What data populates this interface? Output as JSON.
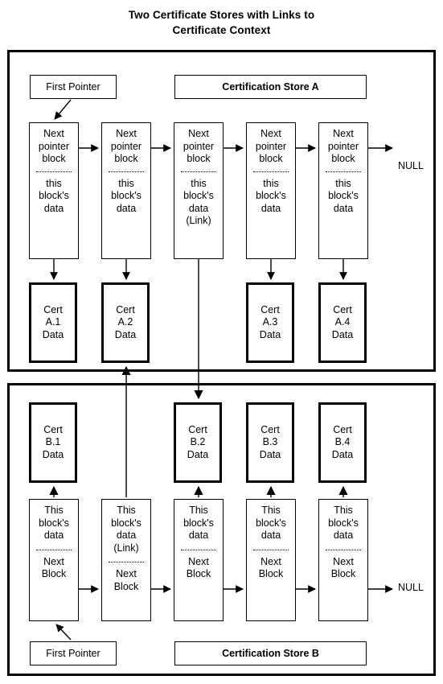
{
  "title": {
    "line1": "Two Certificate Stores with Links to",
    "line2": "Certificate Context"
  },
  "colors": {
    "stroke": "#000000",
    "background": "#ffffff"
  },
  "store_a": {
    "header_label": "Certification Store A",
    "first_pointer_label": "First Pointer",
    "terminator_label": "NULL",
    "nodes": [
      {
        "pointer_part": "Next\npointer\nblock",
        "pointer_l1": "Next",
        "pointer_l2": "pointer",
        "pointer_l3": "block",
        "data_l1": "this",
        "data_l2": "block's",
        "data_l3": "data",
        "data_l4": ""
      },
      {
        "pointer_l1": "Next",
        "pointer_l2": "pointer",
        "pointer_l3": "block",
        "data_l1": "this",
        "data_l2": "block's",
        "data_l3": "data",
        "data_l4": ""
      },
      {
        "pointer_l1": "Next",
        "pointer_l2": "pointer",
        "pointer_l3": "block",
        "data_l1": "this",
        "data_l2": "block's",
        "data_l3": "data",
        "data_l4": "(Link)"
      },
      {
        "pointer_l1": "Next",
        "pointer_l2": "pointer",
        "pointer_l3": "block",
        "data_l1": "this",
        "data_l2": "block's",
        "data_l3": "data",
        "data_l4": ""
      },
      {
        "pointer_l1": "Next",
        "pointer_l2": "pointer",
        "pointer_l3": "block",
        "data_l1": "this",
        "data_l2": "block's",
        "data_l3": "data",
        "data_l4": ""
      }
    ],
    "certs": [
      {
        "l1": "Cert",
        "l2": "A.1",
        "l3": "Data",
        "emphasized": true
      },
      {
        "l1": "Cert",
        "l2": "A.2",
        "l3": "Data",
        "emphasized": true
      },
      {
        "l1": "Cert",
        "l2": "A.3",
        "l3": "Data",
        "emphasized": true
      },
      {
        "l1": "Cert",
        "l2": "A.4",
        "l3": "Data",
        "emphasized": true
      }
    ]
  },
  "store_b": {
    "header_label": "Certification Store B",
    "first_pointer_label": "First Pointer",
    "terminator_label": "NULL",
    "certs": [
      {
        "l1": "Cert",
        "l2": "B.1",
        "l3": "Data",
        "emphasized": true
      },
      {
        "l1": "Cert",
        "l2": "B.2",
        "l3": "Data",
        "emphasized": true
      },
      {
        "l1": "Cert",
        "l2": "B.3",
        "l3": "Data",
        "emphasized": true
      },
      {
        "l1": "Cert",
        "l2": "B.4",
        "l3": "Data",
        "emphasized": true
      }
    ],
    "nodes": [
      {
        "data_l1": "This",
        "data_l2": "block's",
        "data_l3": "data",
        "data_l4": "",
        "pointer_l1": "Next",
        "pointer_l2": "Block"
      },
      {
        "data_l1": "This",
        "data_l2": "block's",
        "data_l3": "data",
        "data_l4": "(Link)",
        "pointer_l1": "Next",
        "pointer_l2": "Block"
      },
      {
        "data_l1": "This",
        "data_l2": "block's",
        "data_l3": "data",
        "data_l4": "",
        "pointer_l1": "Next",
        "pointer_l2": "Block"
      },
      {
        "data_l1": "This",
        "data_l2": "block's",
        "data_l3": "data",
        "data_l4": "",
        "pointer_l1": "Next",
        "pointer_l2": "Block"
      },
      {
        "data_l1": "This",
        "data_l2": "block's",
        "data_l3": "data",
        "data_l4": "",
        "pointer_l1": "Next",
        "pointer_l2": "Block"
      }
    ]
  }
}
